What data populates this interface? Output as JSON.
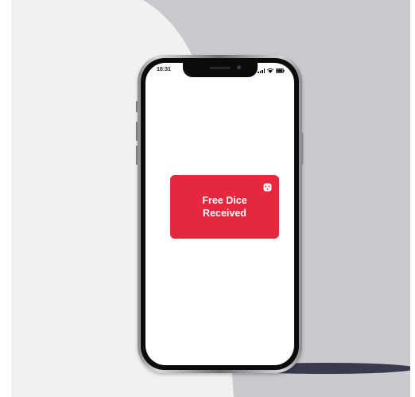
{
  "status_bar": {
    "time": "10:31",
    "icons": [
      "signal-icon",
      "wifi-icon",
      "battery-icon"
    ]
  },
  "notification": {
    "message": "Free Dice Received",
    "icon": "dice-icon",
    "background_color": "#e5283e",
    "text_color": "#ffffff"
  },
  "colors": {
    "backdrop_light": "#f1f1f2",
    "backdrop_gray": "#c9c9ce",
    "screen": "#ffffff"
  }
}
